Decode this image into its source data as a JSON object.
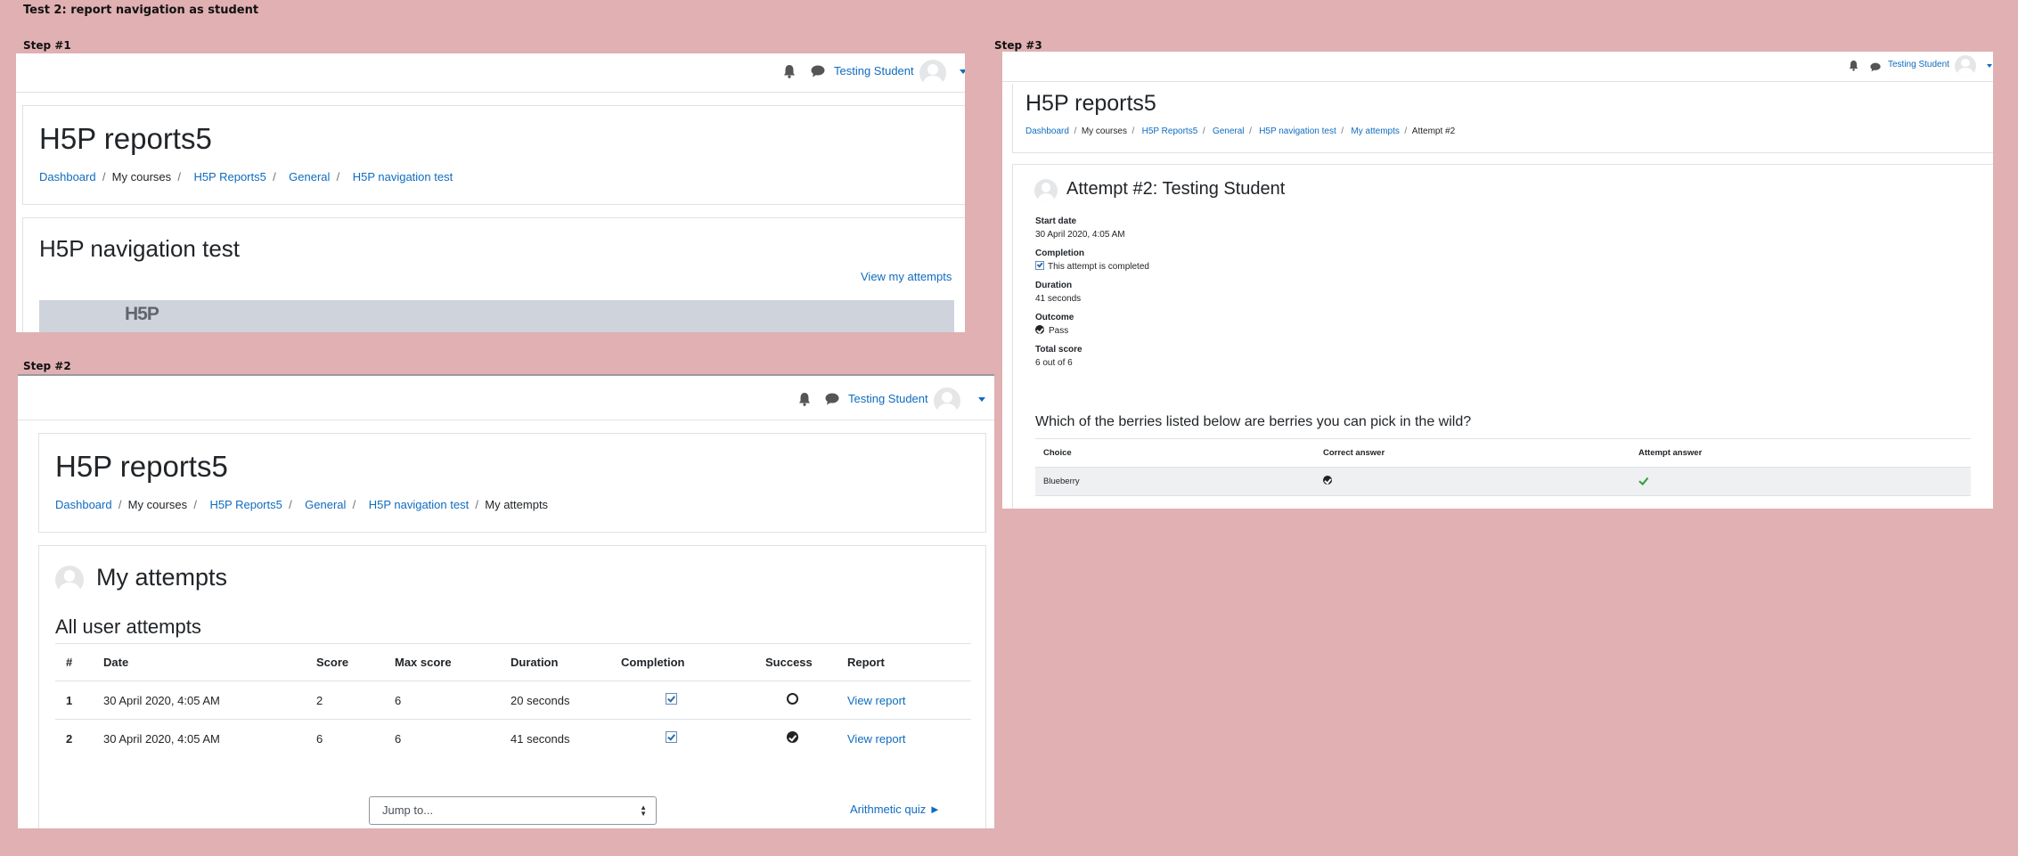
{
  "test_title": "Test 2: report navigation as student",
  "steps": {
    "step1": "Step #1",
    "step2": "Step #2",
    "step3": "Step #3"
  },
  "user": {
    "name": "Testing Student"
  },
  "icons": [
    "bell-icon",
    "chat-icon",
    "avatar",
    "caret-down-icon",
    "check-box-icon",
    "circle-icon",
    "check-circle-icon",
    "green-check-icon"
  ],
  "colors": {
    "background": "#e0b0b2",
    "link": "#0f6cbf",
    "h5p_banner": "#cfd4dc"
  },
  "shot1": {
    "page_title": "H5P reports5",
    "breadcrumb": [
      "Dashboard",
      "My courses",
      "H5P Reports5",
      "General",
      "H5P navigation test"
    ],
    "activity_title": "H5P navigation test",
    "view_attempts": "View my attempts",
    "h5p_logo": "H5P"
  },
  "shot2": {
    "page_title": "H5P reports5",
    "breadcrumb": [
      "Dashboard",
      "My courses",
      "H5P Reports5",
      "General",
      "H5P navigation test",
      "My attempts"
    ],
    "heading": "My attempts",
    "subheading": "All user attempts",
    "columns": [
      "#",
      "Date",
      "Score",
      "Max score",
      "Duration",
      "Completion",
      "Success",
      "Report"
    ],
    "rows": [
      {
        "num": "1",
        "date": "30 April 2020, 4:05 AM",
        "score": "2",
        "max": "6",
        "duration": "20 seconds",
        "success": "fail",
        "report": "View report"
      },
      {
        "num": "2",
        "date": "30 April 2020, 4:05 AM",
        "score": "6",
        "max": "6",
        "duration": "41 seconds",
        "success": "pass",
        "report": "View report"
      }
    ],
    "jump_to": "Jump to...",
    "next_activity": "Arithmetic quiz ►"
  },
  "shot3": {
    "page_title": "H5P reports5",
    "breadcrumb": [
      "Dashboard",
      "My courses",
      "H5P Reports5",
      "General",
      "H5P navigation test",
      "My attempts",
      "Attempt #2"
    ],
    "heading": "Attempt #2: Testing Student",
    "fields": {
      "start_label": "Start date",
      "start_value": "30 April 2020, 4:05 AM",
      "completion_label": "Completion",
      "completion_value": "This attempt is completed",
      "duration_label": "Duration",
      "duration_value": "41 seconds",
      "outcome_label": "Outcome",
      "outcome_value": "Pass",
      "total_label": "Total score",
      "total_value": "6 out of 6"
    },
    "question": "Which of the berries listed below are berries you can pick in the wild?",
    "columns": [
      "Choice",
      "Correct answer",
      "Attempt answer"
    ],
    "rows": [
      {
        "choice": "Blueberry"
      }
    ]
  }
}
